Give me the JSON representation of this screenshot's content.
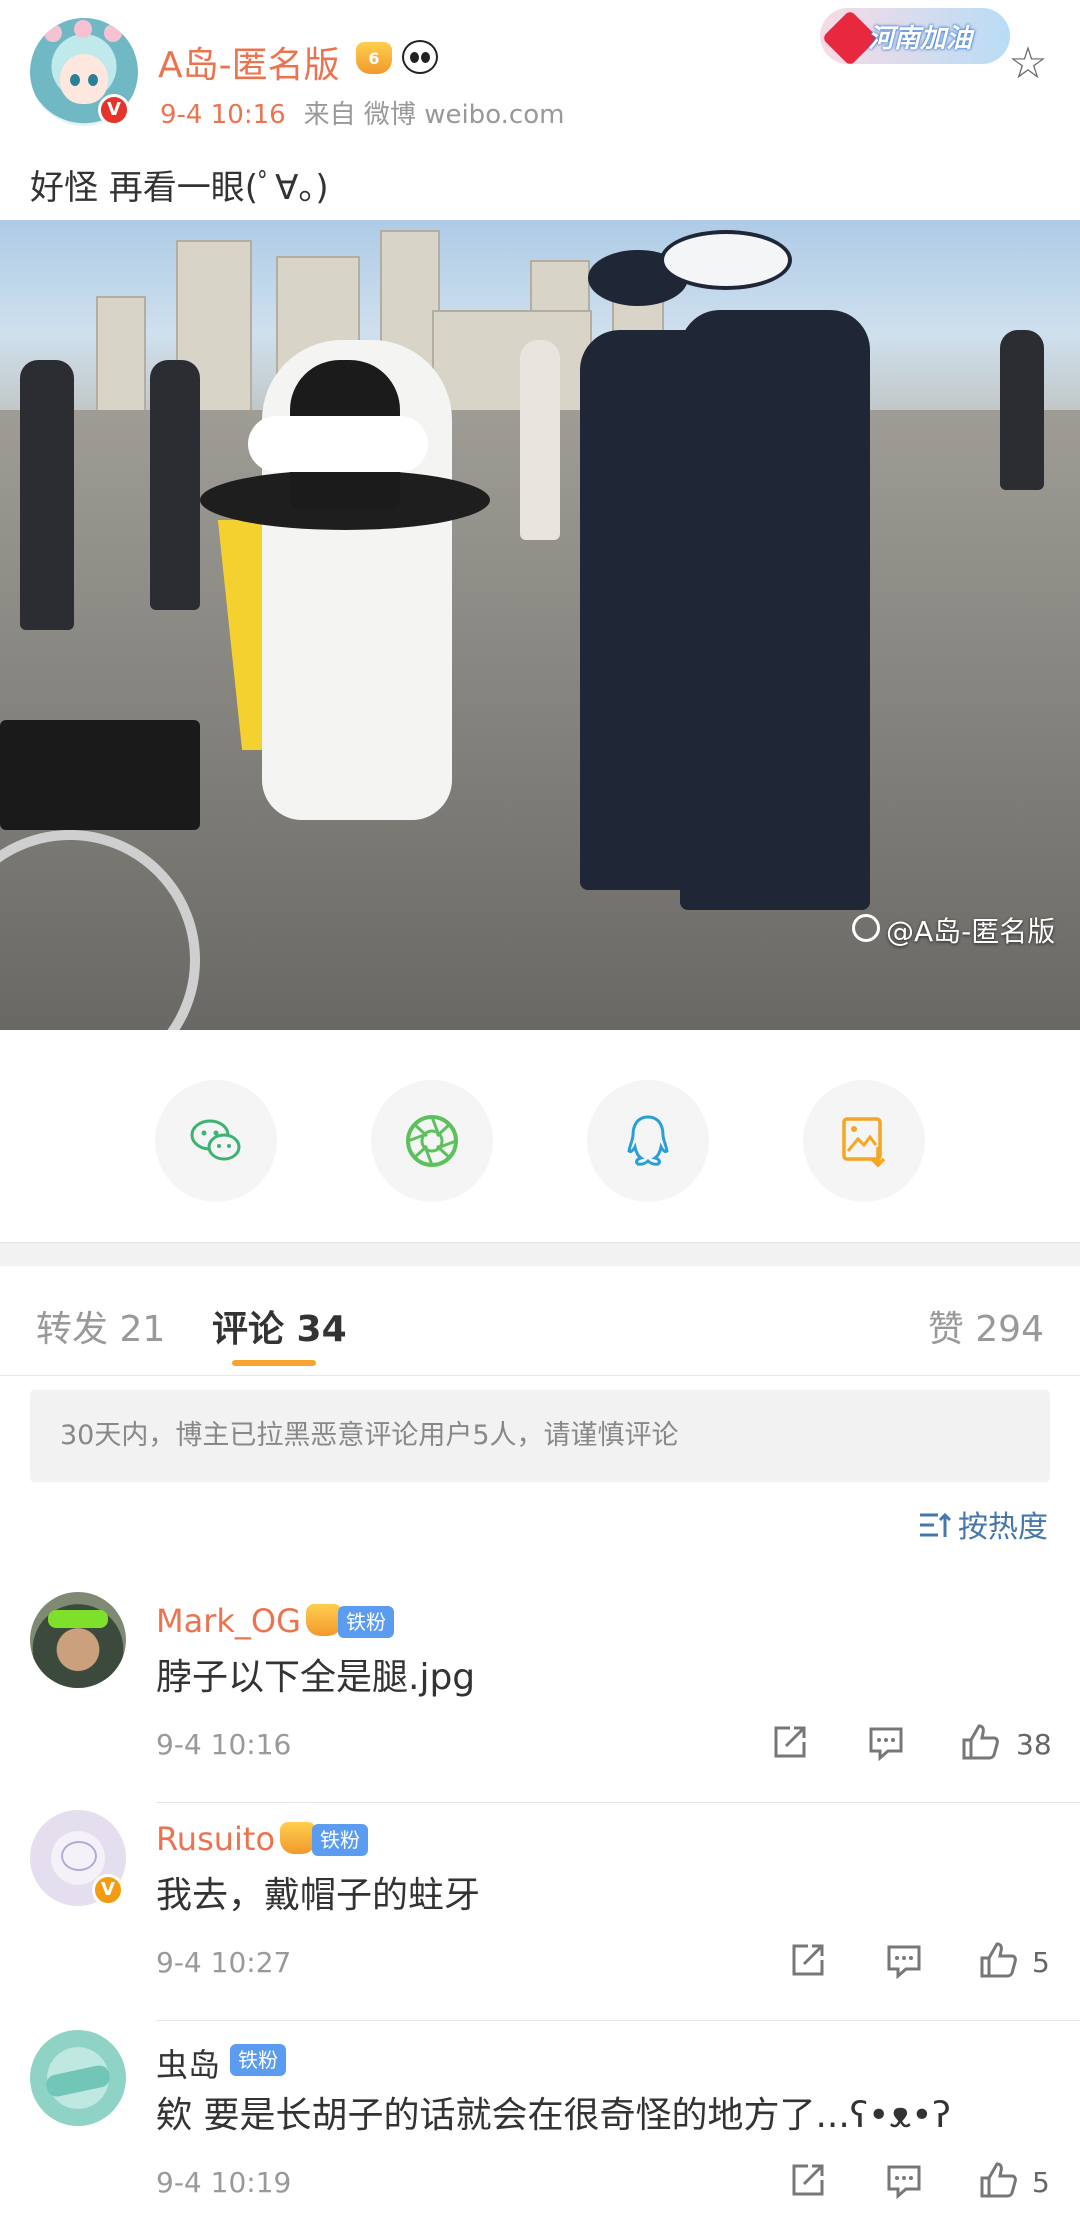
{
  "post": {
    "author": "A岛-匿名版",
    "author_badge": "6",
    "time": "9-4 10:16",
    "source": "来自 微博 weibo.com",
    "text": "好怪 再看一眼(ﾟ∀。)",
    "promo_banner": "河南加油",
    "photo_watermark": "@A岛-匿名版"
  },
  "share": {
    "items": [
      "wechat-icon",
      "moments-icon",
      "qq-icon",
      "save-image-icon"
    ],
    "colors": {
      "wechat": "#3cb371",
      "moments": "#5cc15c",
      "qq": "#2a9fd6",
      "save": "#f5a623"
    }
  },
  "tabs": {
    "repost": "转发 21",
    "comments": "评论 34",
    "likes": "赞 294"
  },
  "notice": "30天内，博主已拉黑恶意评论用户5人，请谨慎评论",
  "sort_label": "按热度",
  "comments": [
    {
      "name": "Mark_OG",
      "badge": "铁粉",
      "text": "脖子以下全是腿.jpg",
      "time": "9-4 10:16",
      "likes": "38"
    },
    {
      "name": "Rusuito",
      "badge": "铁粉",
      "text": "我去，戴帽子的蛀牙",
      "time": "9-4 10:27",
      "likes": "5"
    },
    {
      "name": "虫岛",
      "badge": "铁粉",
      "text": "欸 要是长胡子的话就会在很奇怪的地方了...ʕ•ᴥ•ʔ",
      "time": "9-4 10:19",
      "likes": "5"
    }
  ],
  "colors": {
    "accent": "#eb7350",
    "tab_indicator": "#f7a42e",
    "link": "#4477aa",
    "badge_blue": "#5b9cf0"
  }
}
